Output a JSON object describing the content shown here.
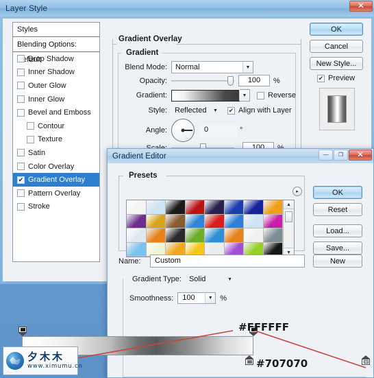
{
  "desktop": {
    "bg_light": "#5c93c8",
    "bg_dark": "#1c5585"
  },
  "layer_style": {
    "title": "Layer Style",
    "close_label": "✕",
    "styles_panel": {
      "header": "Styles",
      "blending_options": "Blending Options: Default",
      "items": [
        {
          "label": "Drop Shadow",
          "checked": false,
          "indent": false,
          "selected": false
        },
        {
          "label": "Inner Shadow",
          "checked": false,
          "indent": false,
          "selected": false
        },
        {
          "label": "Outer Glow",
          "checked": false,
          "indent": false,
          "selected": false
        },
        {
          "label": "Inner Glow",
          "checked": false,
          "indent": false,
          "selected": false
        },
        {
          "label": "Bevel and Emboss",
          "checked": false,
          "indent": false,
          "selected": false
        },
        {
          "label": "Contour",
          "checked": false,
          "indent": true,
          "selected": false
        },
        {
          "label": "Texture",
          "checked": false,
          "indent": true,
          "selected": false
        },
        {
          "label": "Satin",
          "checked": false,
          "indent": false,
          "selected": false
        },
        {
          "label": "Color Overlay",
          "checked": false,
          "indent": false,
          "selected": false
        },
        {
          "label": "Gradient Overlay",
          "checked": true,
          "indent": false,
          "selected": true
        },
        {
          "label": "Pattern Overlay",
          "checked": false,
          "indent": false,
          "selected": false
        },
        {
          "label": "Stroke",
          "checked": false,
          "indent": false,
          "selected": false
        }
      ]
    },
    "section_title": "Gradient Overlay",
    "group_title": "Gradient",
    "fields": {
      "blend_mode_label": "Blend Mode:",
      "blend_mode_value": "Normal",
      "opacity_label": "Opacity:",
      "opacity_value": "100",
      "opacity_unit": "%",
      "gradient_label": "Gradient:",
      "reverse_label": "Reverse",
      "reverse_checked": false,
      "style_label": "Style:",
      "style_value": "Reflected",
      "align_label": "Align with Layer",
      "align_checked": true,
      "angle_label": "Angle:",
      "angle_value": "0",
      "angle_unit": "°",
      "scale_label": "Scale:",
      "scale_value": "100",
      "scale_unit": "%"
    },
    "buttons": {
      "ok": "OK",
      "cancel": "Cancel",
      "new_style": "New Style..."
    },
    "preview_label": "Preview",
    "preview_checked": true
  },
  "gradient_editor": {
    "title": "Gradient Editor",
    "minimize_label": "—",
    "maximize_label": "❐",
    "close_label": "✕",
    "presets_title": "Presets",
    "presets_menu_icon": "▸",
    "scroll_up_icon": "▲",
    "scroll_down_icon": "▼",
    "presets": [
      [
        "#f4f4f4",
        "#cfe4f5",
        "#1a1a1a",
        "#b81414",
        "#2a1f4e",
        "#1b3fb0",
        "#15239a",
        "#f0a018"
      ],
      [
        "#6d2f8e",
        "#d7a41a",
        "#8a5a30",
        "#2f86d6",
        "#d81f1f",
        "#2f7fd6",
        "#cfe3f6",
        "#c81fa8"
      ],
      [
        "#dfe9f2",
        "#e8821a",
        "#2a2a2a",
        "#6cae2a",
        "#2f8fd6",
        "#e8821a",
        "#f0f0f0",
        "#7e8c94"
      ],
      [
        "#79c3ee",
        "#eef4d6",
        "#f0a91a",
        "#f5c518",
        "#e9edf0",
        "#a24fd0",
        "#97cf2a",
        "#171717"
      ]
    ],
    "name_label": "Name:",
    "name_value": "Custom",
    "new_button": "New",
    "gradient_type_label": "Gradient Type:",
    "gradient_type_value": "Solid",
    "smoothness_label": "Smoothness:",
    "smoothness_value": "100",
    "smoothness_unit": "%",
    "buttons": {
      "ok": "OK",
      "reset": "Reset",
      "load": "Load...",
      "save": "Save..."
    },
    "annotations": {
      "white_hex": "#FFFFFF",
      "gray_hex": "#707070",
      "line_color": "#c8463c"
    }
  },
  "watermark": {
    "cn_text": "夕木木",
    "url_text": "www.ximumu.cn"
  }
}
